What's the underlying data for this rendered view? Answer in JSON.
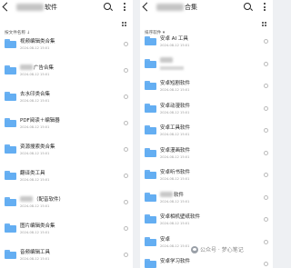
{
  "left": {
    "title_suffix": "软件",
    "sort_label": "按文件名称 ↓",
    "rows": [
      {
        "name": "视频编辑类合集",
        "date": "2024-08-12 15:01"
      },
      {
        "name": "广告合集",
        "date": "2024-08-12 15:01",
        "blur_prefix": true
      },
      {
        "name": "去水印类合集",
        "date": "2024-08-12 15:01"
      },
      {
        "name": "PDF阅读＋编辑器",
        "date": "2024-08-12 15:01"
      },
      {
        "name": "资源搜索类合集",
        "date": "2024-08-12 15:01"
      },
      {
        "name": "翻译类工具",
        "date": "2024-08-12 15:01"
      },
      {
        "name": "（配音软件）",
        "date": "2024-08-12 15:01",
        "blur_prefix": true
      },
      {
        "name": "图片编辑类合集",
        "date": "2024-08-12 15:01"
      },
      {
        "name": "音频编辑工具",
        "date": "2024-08-12 15:01"
      }
    ]
  },
  "right": {
    "title_suffix": "合集",
    "sort_label": "排序软件 ▾",
    "rows": [
      {
        "name": "安卓 AI 工具",
        "date": "2024-08-12 15:01"
      },
      {
        "name": "",
        "date": "",
        "blur_prefix": true,
        "blur_date": true
      },
      {
        "name": "安卓短剧软件",
        "date": "2024-08-12 15:01"
      },
      {
        "name": "安卓动漫软件",
        "date": "2024-08-12 15:01"
      },
      {
        "name": "安卓工具软件",
        "date": "2024-08-12 15:01"
      },
      {
        "name": "安卓漫画软件",
        "date": "2024-08-12 15:01"
      },
      {
        "name": "安卓听书软件",
        "date": "2024-08-12 15:01"
      },
      {
        "name": "软件",
        "date": "2024-08-12 15:01",
        "blur_prefix": true
      },
      {
        "name": "安卓相机壁纸软件",
        "date": "2024-08-12 15:01"
      },
      {
        "name": "安卓",
        "date": "2024-08-12 15:01"
      },
      {
        "name": "安卓学习软件",
        "date": ""
      }
    ]
  },
  "watermark": {
    "text": "公众号 · 梦心笔记"
  },
  "icons": {
    "back": "chevron-left-icon",
    "search": "search-icon",
    "more": "more-vertical-icon",
    "view": "grid-view-icon",
    "folder": "folder-icon",
    "row_menu": "circle-menu-icon"
  },
  "colors": {
    "folder": "#64aef2",
    "background": "#ffffff"
  }
}
